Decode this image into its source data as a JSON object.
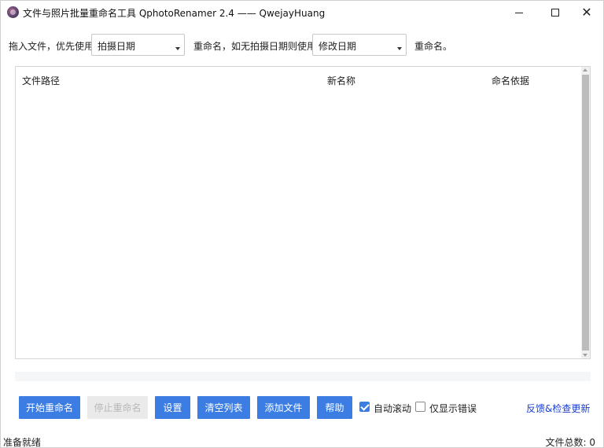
{
  "window": {
    "title": "文件与照片批量重命名工具 QphotoRenamer 2.4 —— QwejayHuang",
    "minimize_icon": "minimize-icon",
    "maximize_icon": "maximize-icon",
    "close_icon": "close-icon",
    "close_glyph": "✕"
  },
  "options": {
    "label_prefix": "拖入文件，优先使用",
    "primary_select": "拍摄日期",
    "label_middle": "重命名，如无拍摄日期则使用",
    "fallback_select": "修改日期",
    "label_suffix": "重命名。"
  },
  "table": {
    "columns": [
      "文件路径",
      "新名称",
      "命名依据"
    ],
    "rows": []
  },
  "progress": {
    "value_percent": 0
  },
  "buttons": {
    "start": "开始重命名",
    "stop": "停止重命名",
    "settings": "设置",
    "clear": "清空列表",
    "add": "添加文件",
    "help": "帮助"
  },
  "checkboxes": {
    "auto_scroll": {
      "label": "自动滚动",
      "checked": true
    },
    "errors_only": {
      "label": "仅显示错误",
      "checked": false
    }
  },
  "feedback_link": "反馈&检查更新",
  "status": {
    "left": "准备就绪",
    "right": "文件总数: 0"
  },
  "colors": {
    "accent": "#3b7de3",
    "link": "#1a3fd0",
    "disabled_bg": "#eaeaea"
  }
}
